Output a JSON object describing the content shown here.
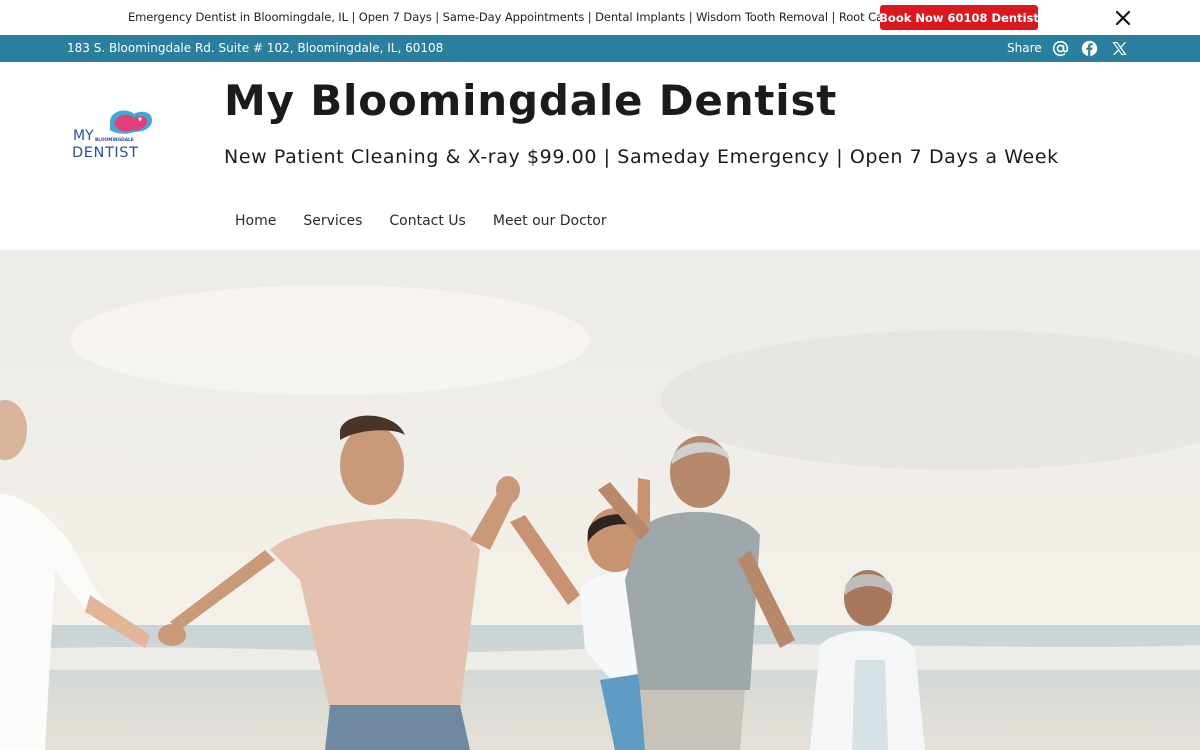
{
  "announcement": {
    "text": "Emergency Dentist in Bloomingdale, IL | Open 7 Days | Same-Day Appointments | Dental Implants | Wisdom Tooth Removal | Root Canal",
    "button_label": "Book Now 60108 Dentist",
    "close_icon": "close-icon"
  },
  "infobar": {
    "address": "183 S. Bloomingdale Rd. Suite # 102, Bloomingdale, IL, 60108",
    "share_label": "Share",
    "icons": [
      "at-icon",
      "facebook-icon",
      "x-twitter-icon"
    ]
  },
  "logo": {
    "line1": "MY",
    "line2": "BLOOMINGDALE",
    "line3": "DENTIST"
  },
  "header": {
    "title": "My Bloomingdale Dentist",
    "tagline": "New Patient Cleaning & X-ray $99.00 | Sameday Emergency | Open 7 Days a Week"
  },
  "nav": {
    "items": [
      "Home",
      "Services",
      "Contact Us",
      "Meet our Doctor"
    ]
  },
  "colors": {
    "infobar": "#2a7f9e",
    "button": "#d9181f",
    "logo_blue": "#2a4f9e",
    "logo_pink": "#e0407a",
    "logo_teal": "#3fa9d4"
  }
}
